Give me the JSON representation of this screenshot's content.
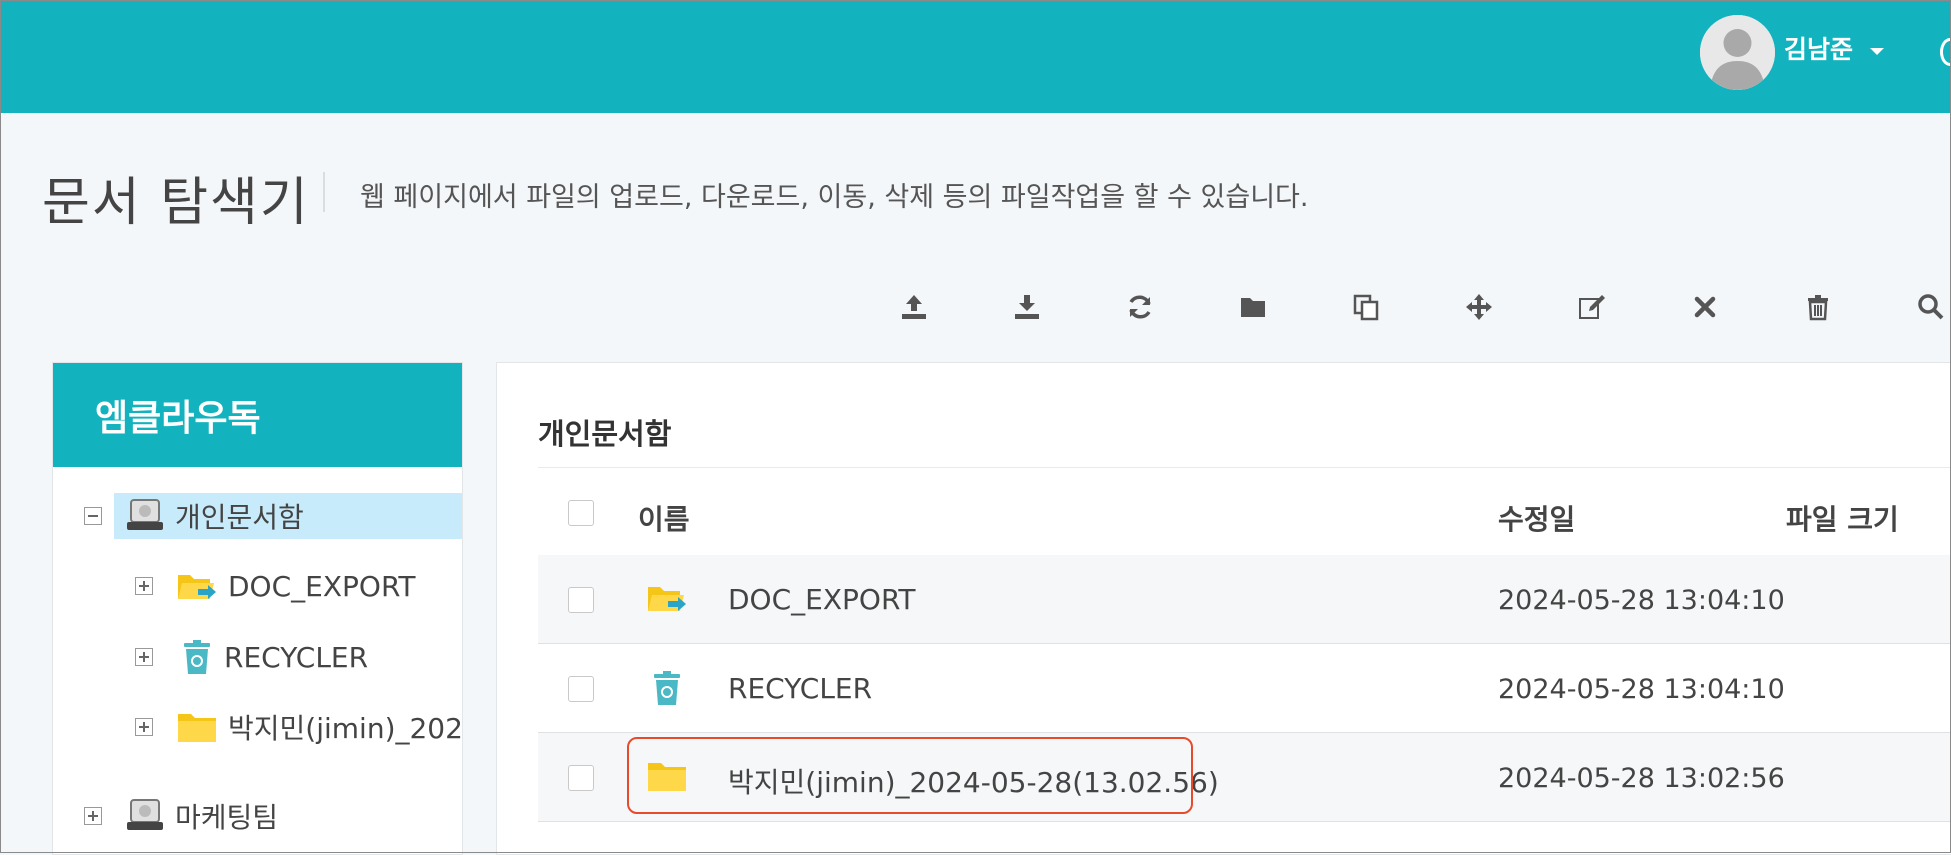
{
  "header": {
    "username": "김남준",
    "accent_color": "#12b3be"
  },
  "page": {
    "title": "문서 탐색기",
    "description": "웹 페이지에서 파일의 업로드, 다운로드, 이동, 삭제 등의 파일작업을 할 수 있습니다."
  },
  "toolbar": [
    {
      "name": "upload",
      "icon": "upload-icon",
      "glyph": "⤒"
    },
    {
      "name": "download",
      "icon": "download-icon",
      "glyph": "⤓"
    },
    {
      "name": "refresh",
      "icon": "refresh-icon",
      "glyph": "⟳"
    },
    {
      "name": "new-folder",
      "icon": "folder-icon",
      "glyph": "▬"
    },
    {
      "name": "copy",
      "icon": "copy-icon",
      "glyph": "⧉"
    },
    {
      "name": "move",
      "icon": "move-icon",
      "glyph": "✥"
    },
    {
      "name": "rename",
      "icon": "edit-icon",
      "glyph": "✎"
    },
    {
      "name": "cancel",
      "icon": "close-icon",
      "glyph": "✖"
    },
    {
      "name": "delete",
      "icon": "trash-icon",
      "glyph": "🗑"
    },
    {
      "name": "search",
      "icon": "search-icon",
      "glyph": "⌕"
    }
  ],
  "sidebar": {
    "title": "엠클라우독",
    "tree": [
      {
        "label": "개인문서함",
        "icon": "drive-icon",
        "expanded": true,
        "selected": true
      },
      {
        "label": "DOC_EXPORT",
        "icon": "folder-export-icon"
      },
      {
        "label": "RECYCLER",
        "icon": "recycle-bin-icon"
      },
      {
        "label": "박지민(jimin)_2024-05-28(13.02.56)",
        "icon": "folder-icon"
      },
      {
        "label": "마케팅팀",
        "icon": "drive-icon"
      }
    ]
  },
  "content": {
    "title": "개인문서함",
    "columns": {
      "name": "이름",
      "modified": "수정일",
      "size": "파일 크기"
    },
    "rows": [
      {
        "name": "DOC_EXPORT",
        "modified": "2024-05-28 13:04:10",
        "size": "",
        "icon": "folder-export-icon"
      },
      {
        "name": "RECYCLER",
        "modified": "2024-05-28 13:04:10",
        "size": "",
        "icon": "recycle-bin-icon"
      },
      {
        "name": "박지민(jimin)_2024-05-28(13.02.56)",
        "modified": "2024-05-28 13:02:56",
        "size": "",
        "icon": "folder-icon"
      }
    ]
  }
}
